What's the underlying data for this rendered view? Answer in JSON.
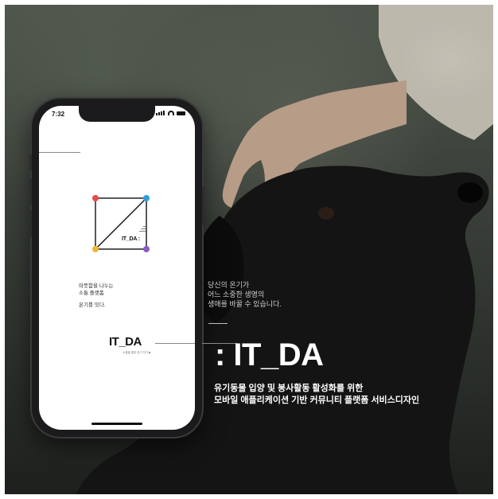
{
  "phone": {
    "status_time": "7:32",
    "logo_text": "IT_DA :",
    "intro_lines": [
      "따뜻함을 나누는",
      "소통 플랫폼"
    ],
    "connect_line": "온기를 잇다.",
    "brand": "IT_DA",
    "brand_sub": "소통을 통한 온기 잇기 ▶"
  },
  "poster": {
    "tagline": [
      "당신의 온기가",
      "어느 소중한 생명의",
      "생애를 바꿀 수 있습니다."
    ],
    "title": ": IT_DA",
    "subtitle": [
      "유기동물 입양 및 봉사활동 활성화를 위한",
      "모바일 애플리케이션 기반 커뮤니티 플랫폼 서비스디자인"
    ]
  },
  "colors": {
    "dot_top_left": "#e84a4a",
    "dot_top_right": "#2f9ed9",
    "dot_bottom_left": "#f2b632",
    "dot_bottom_right": "#8b5bc4"
  },
  "icons": [
    "signal-icon",
    "wifi-icon",
    "battery-icon"
  ]
}
